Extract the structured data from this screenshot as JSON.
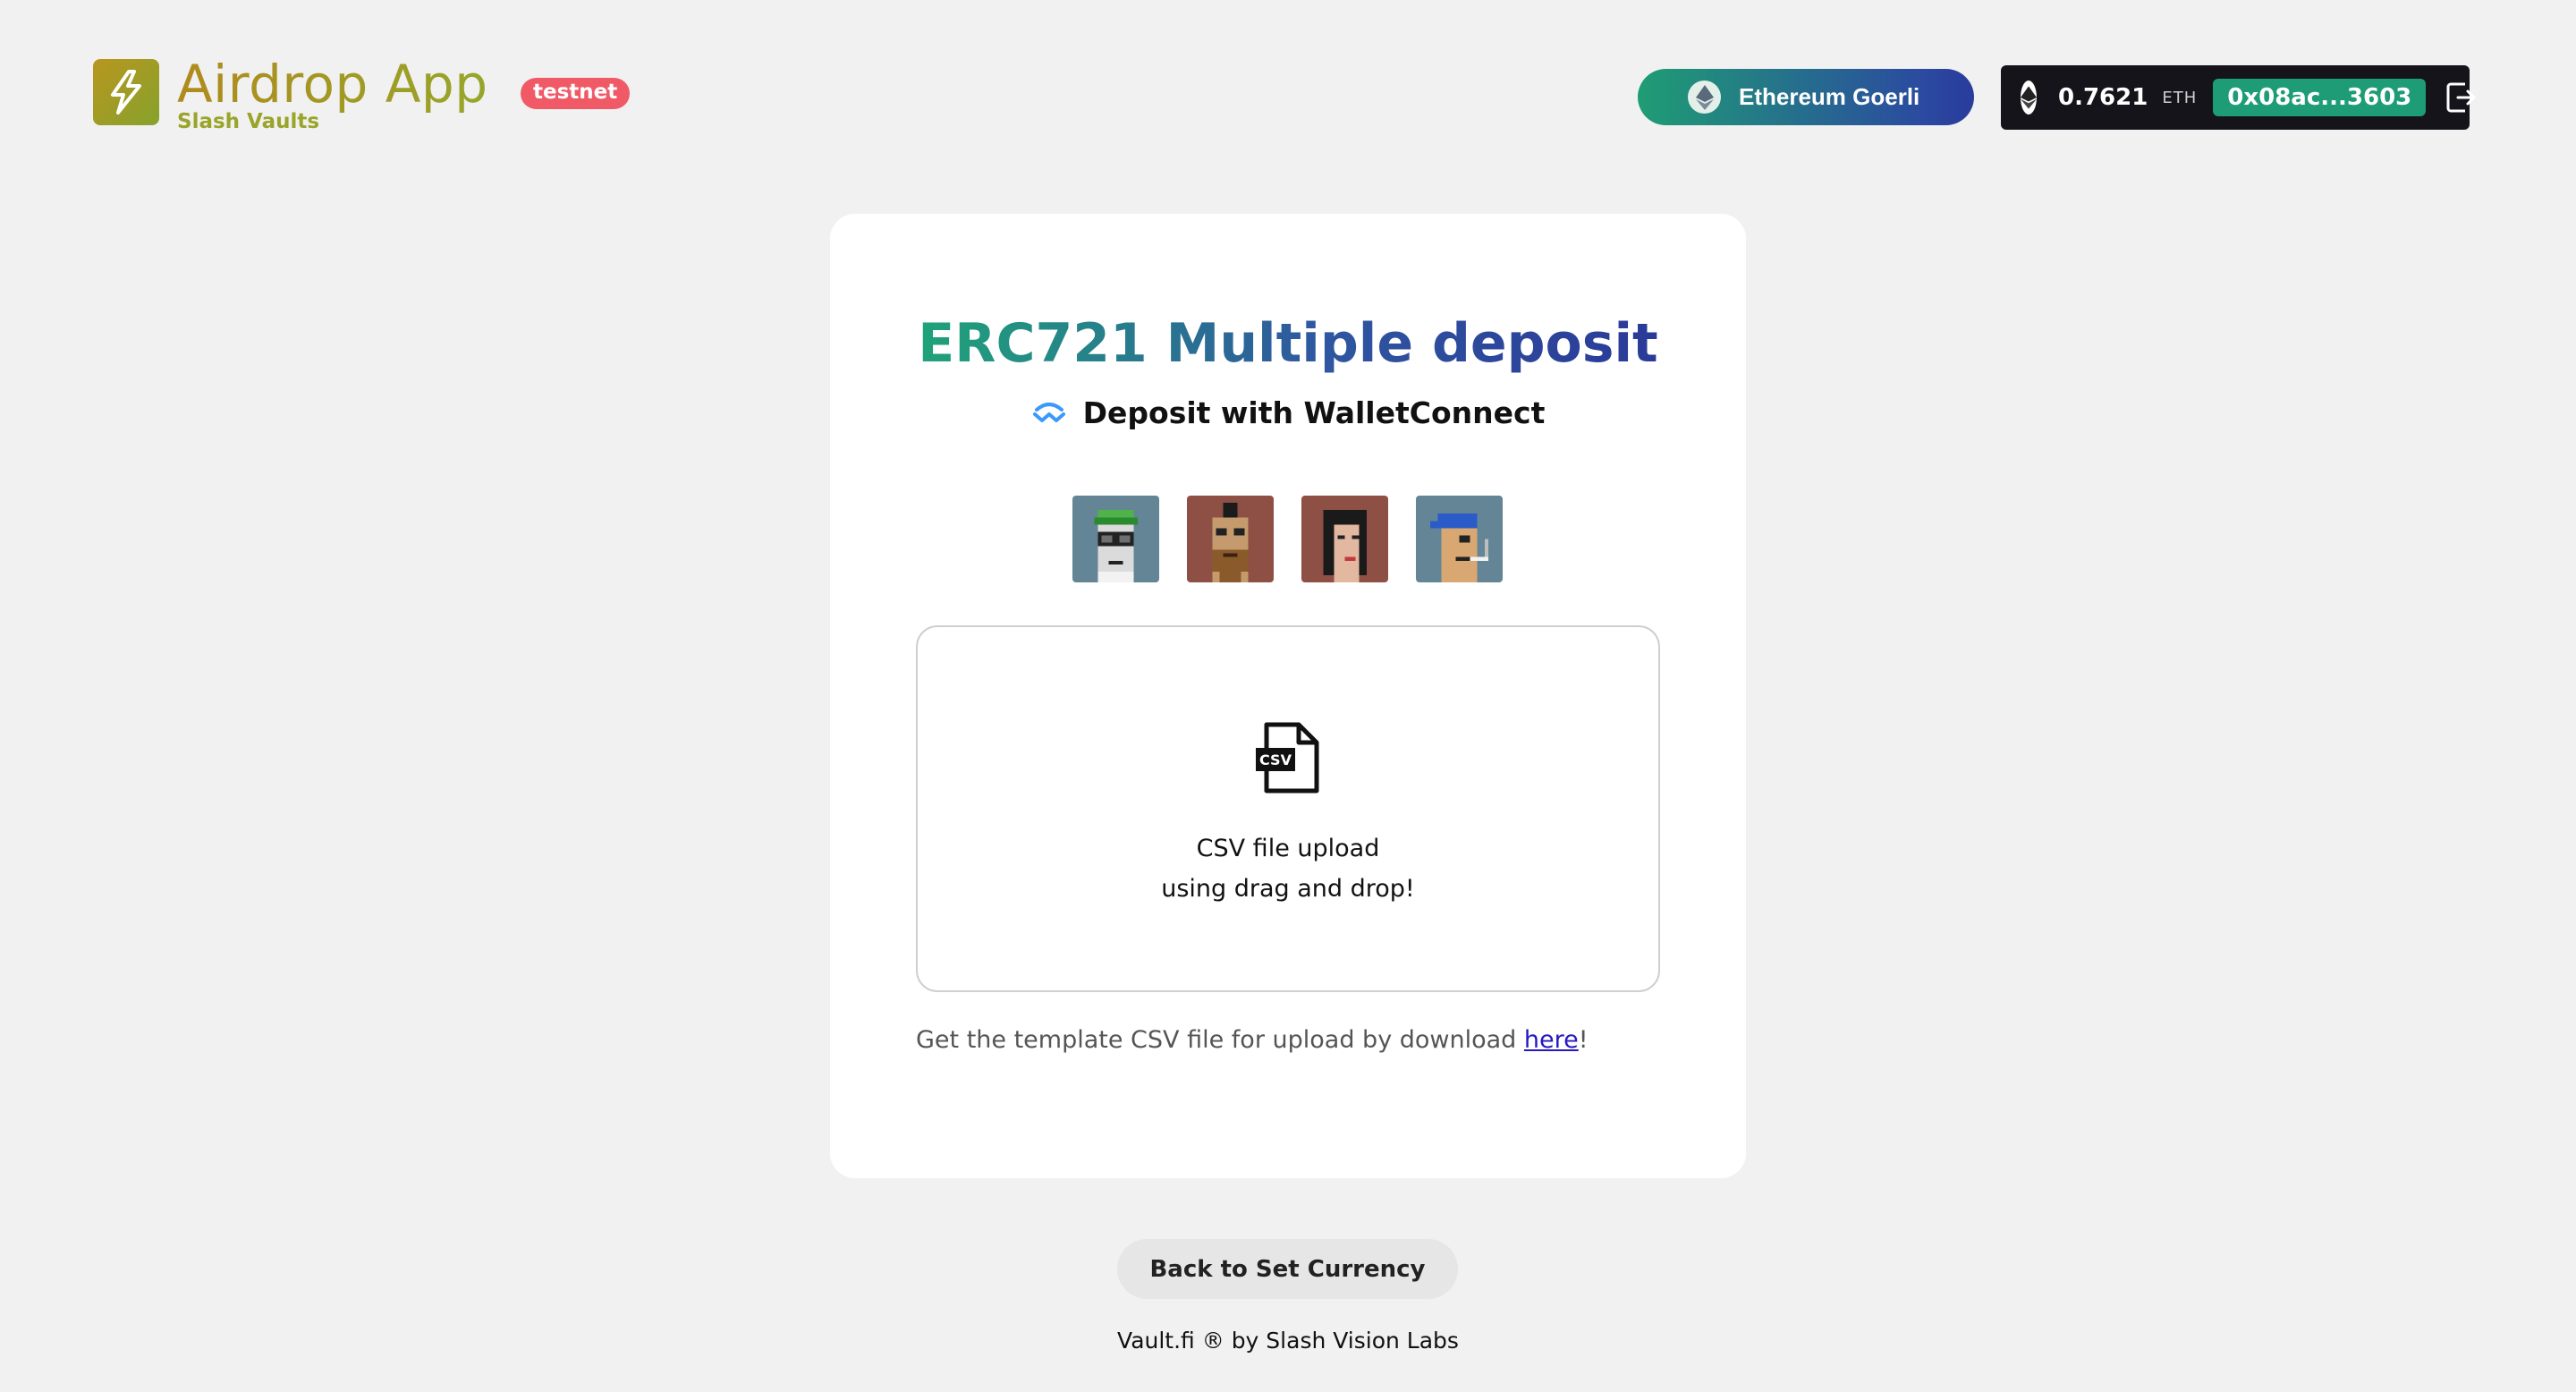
{
  "header": {
    "app_title": "Airdrop App",
    "app_subtitle": "Slash Vaults",
    "env_badge": "testnet",
    "network_label": "Ethereum Goerli",
    "balance": "0.7621",
    "balance_unit": "ETH",
    "address": "0x08ac...3603"
  },
  "card": {
    "title": "ERC721 Multiple deposit",
    "subtitle": "Deposit with WalletConnect",
    "nft_icons": [
      "punk-green-cap-icon",
      "punk-mohawk-beard-icon",
      "punk-dark-hair-icon",
      "punk-blue-bandana-icon"
    ],
    "dropzone": {
      "line1": "CSV file upload",
      "line2": "using drag and drop!",
      "icon_text": "CSV"
    },
    "template_note_prefix": "Get the template CSV file for upload by download ",
    "template_link": "here",
    "template_note_suffix": "!"
  },
  "footer": {
    "back_button": "Back to Set Currency",
    "credit": "Vault.fi ® by Slash Vision Labs"
  },
  "colors": {
    "background": "#f1f1f1",
    "accent_green": "#1e9c76",
    "accent_blue": "#2a3b9c",
    "badge_red": "#ef5a66",
    "wallet_dark": "#14141a"
  }
}
